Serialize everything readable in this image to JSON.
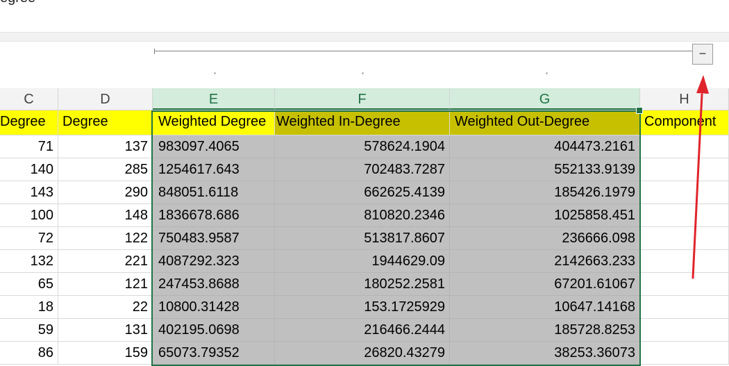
{
  "formula_bar": {
    "text": "egree"
  },
  "group_controls": {
    "collapse_label": "−"
  },
  "columns": [
    {
      "letter": "C",
      "selected": false
    },
    {
      "letter": "D",
      "selected": false
    },
    {
      "letter": "E",
      "selected": true
    },
    {
      "letter": "F",
      "selected": true
    },
    {
      "letter": "G",
      "selected": true
    },
    {
      "letter": "H",
      "selected": false
    }
  ],
  "header_row": {
    "c": "Degree",
    "d": "Degree",
    "e": "Weighted Degree",
    "f": "Weighted In-Degree",
    "g": "Weighted Out-Degree",
    "h": "Component"
  },
  "rows": [
    [
      "71",
      "137",
      "983097.4065",
      "578624.1904",
      "404473.2161"
    ],
    [
      "140",
      "285",
      "1254617.643",
      "702483.7287",
      "552133.9139"
    ],
    [
      "143",
      "290",
      "848051.6118",
      "662625.4139",
      "185426.1979"
    ],
    [
      "100",
      "148",
      "1836678.686",
      "810820.2346",
      "1025858.451"
    ],
    [
      "72",
      "122",
      "750483.9587",
      "513817.8607",
      "236666.098"
    ],
    [
      "132",
      "221",
      "4087292.323",
      "1944629.09",
      "2142663.233"
    ],
    [
      "65",
      "121",
      "247453.8688",
      "180252.2581",
      "67201.61067"
    ],
    [
      "18",
      "22",
      "10800.31428",
      "153.1725929",
      "10647.14168"
    ],
    [
      "59",
      "131",
      "402195.0698",
      "216466.2444",
      "185728.8253"
    ],
    [
      "86",
      "159",
      "65073.79352",
      "26820.43279",
      "38253.36073"
    ]
  ],
  "colors": {
    "header_yellow": "#ffff00",
    "header_olive": "#c6c000",
    "selection_gray": "#c0c0c0",
    "excel_green": "#217346",
    "arrow_red": "#e0242b"
  }
}
